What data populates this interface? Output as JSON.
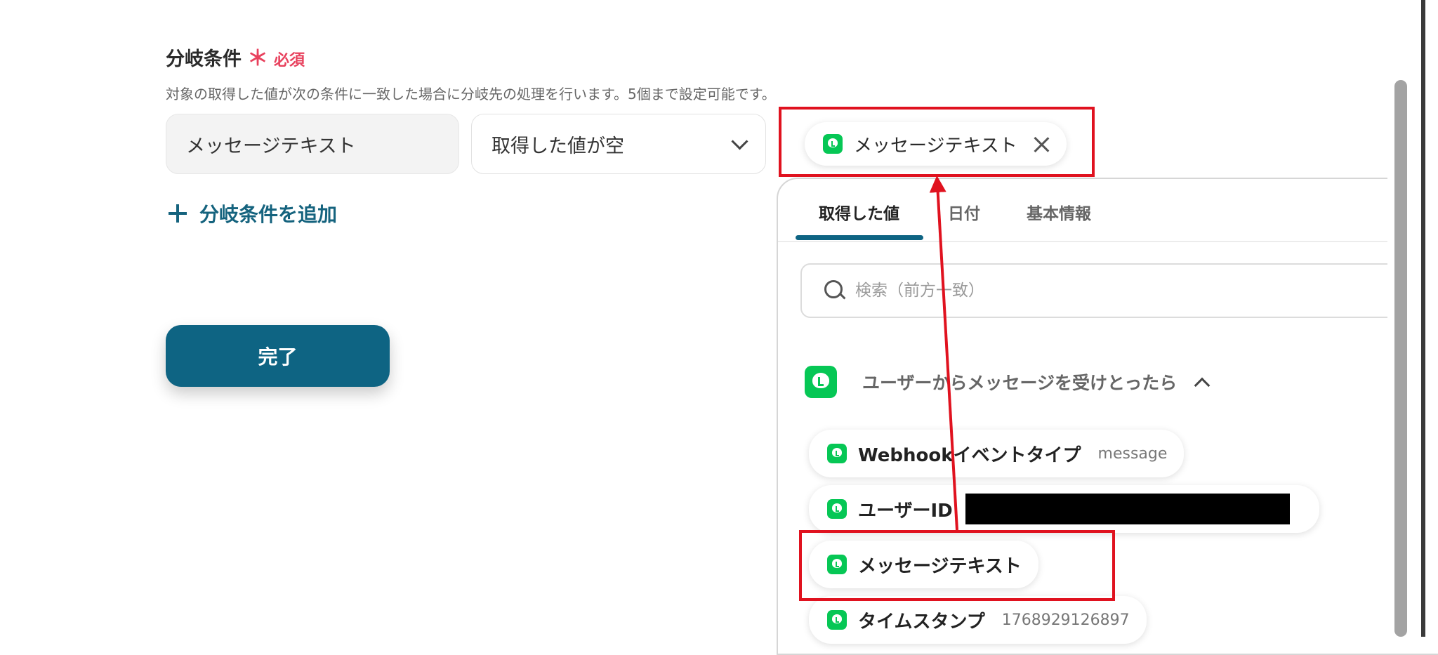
{
  "section": {
    "title": "分岐条件",
    "required_star": "＊",
    "required_label": "必須",
    "description": "対象の取得した値が次の条件に一致した場合に分岐先の処理を行います。5個まで設定可能です。"
  },
  "condition": {
    "field_value": "メッセージテキスト",
    "operator_value": "取得した値が空",
    "selected_value_chip": "メッセージテキスト"
  },
  "add_condition_label": "分岐条件を追加",
  "done_button_label": "完了",
  "panel": {
    "tabs": [
      {
        "label": "取得した値",
        "active": true
      },
      {
        "label": "日付",
        "active": false
      },
      {
        "label": "基本情報",
        "active": false
      }
    ],
    "search_placeholder": "検索（前方一致）",
    "trigger_label": "ユーザーからメッセージを受けとったら",
    "items": [
      {
        "key": "Webhookイベントタイプ",
        "value": "message"
      },
      {
        "key": "ユーザーID",
        "value": ""
      },
      {
        "key": "メッセージテキスト",
        "value": ""
      },
      {
        "key": "タイムスタンプ",
        "value": "1768929126897"
      }
    ]
  },
  "colors": {
    "accent": "#0e6483",
    "required": "#e8415d",
    "line_green": "#06c755",
    "annotation_red": "#e0121f"
  },
  "icons": [
    "line-app-icon",
    "close-icon",
    "chevron-down-icon",
    "chevron-up-icon",
    "search-icon",
    "plus-icon"
  ]
}
